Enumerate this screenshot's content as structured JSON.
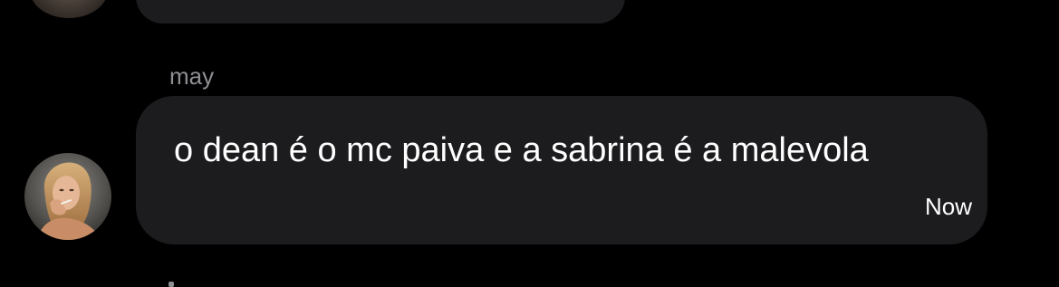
{
  "conversation": {
    "message": {
      "sender": "may",
      "text": "o dean é o mc paiva e a sabrina é a malevola",
      "time": "Now",
      "avatar_icon": "profile-photo",
      "bubble_color": "#1c1c1e"
    }
  },
  "colors": {
    "background": "#000000",
    "bubble": "#1c1c1e",
    "sender_text": "#8e8e93",
    "message_text": "#ffffff"
  }
}
